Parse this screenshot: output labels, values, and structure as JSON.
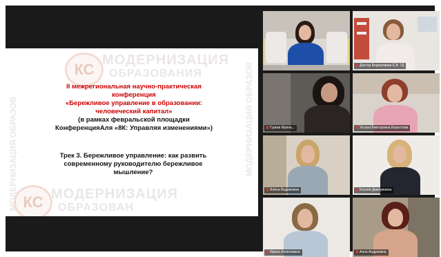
{
  "slide": {
    "line1": "II межрегиональная научно-практическая",
    "line2": "конференция",
    "line3": "«Бережливое управление в образовании:",
    "line4": "человеческий капитал»",
    "line5": "(в рамках февральской площадки",
    "line6": "КонференцияАля «8К: Управляя изменениями»)",
    "track1": "Трек 3. Бережливое управление: как развить",
    "track2": "современному руководителю бережливое",
    "track3": "мышление?",
    "watermark_top1": "МОДЕРНИЗАЦИЯ",
    "watermark_top2": "ОБРАЗОВАНИЯ",
    "watermark_bottom1": "МОДЕРНИЗАЦИЯ",
    "watermark_bottom2": "ОБРАЗОВАН",
    "logo": "КС",
    "vertical_left": "МОДЕРНИЗАЦИЯ ОБРАЗОВ",
    "vertical_right": "МОДЕРНИЗАЦИЯ ОБРАЗОВ"
  },
  "participants": [
    {
      "name": ""
    },
    {
      "name": "Доктор Бережливая Е.В. ГД"
    },
    {
      "name": "Гуркая Ирина..."
    },
    {
      "name": "Уксана Викторовна Берестова"
    },
    {
      "name": "Алёна Вадимовна"
    },
    {
      "name": "Ксения Дмитриевна"
    },
    {
      "name": "Ирина Алексеевна"
    },
    {
      "name": "Анна Андреевна"
    }
  ],
  "colors": {
    "accent_title": "#cc0000",
    "active_speaker": "#f2d23a",
    "background": "#1a1a1a"
  }
}
